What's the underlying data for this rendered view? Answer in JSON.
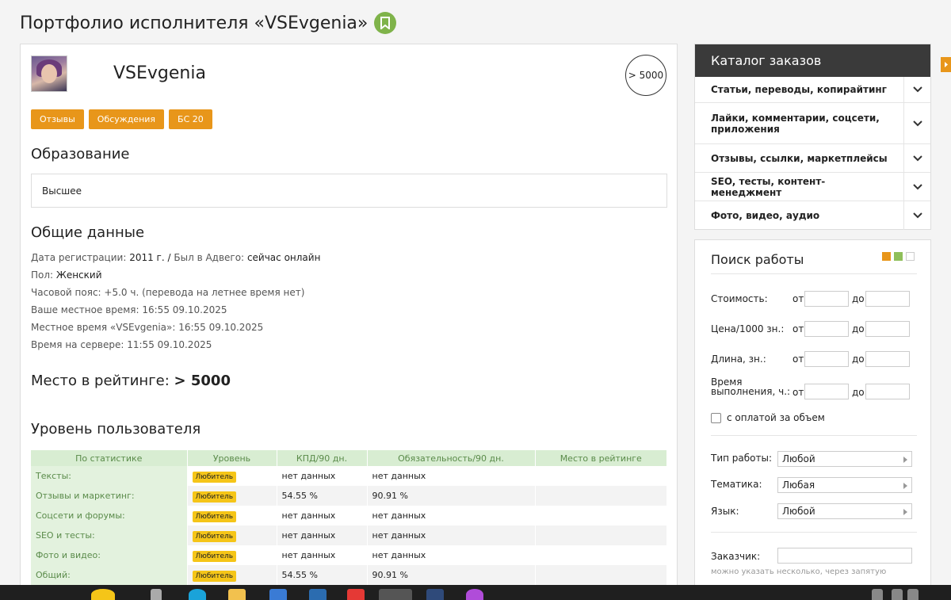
{
  "page": {
    "title": "Портфолио исполнителя «VSEvgenia»"
  },
  "profile": {
    "username": "VSEvgenia",
    "rating_badge": "> 5000"
  },
  "tags": [
    "Отзывы",
    "Обсуждения",
    "БС 20"
  ],
  "education": {
    "heading": "Образование",
    "value": "Высшее"
  },
  "general": {
    "heading": "Общие данные",
    "reg_label": "Дата регистрации:",
    "reg_value": "2011 г.",
    "sep": "/",
    "seen_label": "Был в Адвего:",
    "seen_value": "сейчас онлайн",
    "gender_label": "Пол:",
    "gender_value": "Женский",
    "tz_line": "Часовой пояс: +5.0 ч. (перевода на летнее время нет)",
    "local_time_line": "Ваше местное время: 16:55 09.10.2025",
    "user_time_line": "Местное время «VSEvgenia»: 16:55 09.10.2025",
    "server_time_line": "Время на сервере: 11:55 09.10.2025"
  },
  "rank": {
    "label": "Место в рейтинге:",
    "value": "> 5000"
  },
  "level": {
    "heading": "Уровень пользователя",
    "columns": [
      "По статистике",
      "Уровень",
      "КПД/90 дн.",
      "Обязательность/90 дн.",
      "Место в рейтинге"
    ],
    "rows": [
      {
        "cat": "Тексты:",
        "level": "Любитель",
        "kpd": "нет данных",
        "duty": "нет данных",
        "place": ""
      },
      {
        "cat": "Отзывы и маркетинг:",
        "level": "Любитель",
        "kpd": "54.55 %",
        "duty": "90.91 %",
        "place": ""
      },
      {
        "cat": "Соцсети и форумы:",
        "level": "Любитель",
        "kpd": "нет данных",
        "duty": "нет данных",
        "place": ""
      },
      {
        "cat": "SEO и тесты:",
        "level": "Любитель",
        "kpd": "нет данных",
        "duty": "нет данных",
        "place": ""
      },
      {
        "cat": "Фото и видео:",
        "level": "Любитель",
        "kpd": "нет данных",
        "duty": "нет данных",
        "place": ""
      },
      {
        "cat": "Общий:",
        "level": "Любитель",
        "kpd": "54.55 %",
        "duty": "90.91 %",
        "place": ""
      }
    ]
  },
  "catalog": {
    "heading": "Каталог заказов",
    "items": [
      "Статьи, переводы, копирайтинг",
      "Лайки, комментарии, соцсети, приложения",
      "Отзывы, ссылки, маркетплейсы",
      "SEO, тесты, контент-менеджмент",
      "Фото, видео, аудио"
    ]
  },
  "search": {
    "heading": "Поиск работы",
    "view_colors": [
      "#e8961a",
      "#8fbf5a",
      "#ffffff"
    ],
    "from": "от",
    "to": "до",
    "cost_label": "Стоимость:",
    "price_label": "Цена/1000 зн.:",
    "length_label": "Длина, зн.:",
    "time_label_1": "Время",
    "time_label_2": "выполнения, ч.:",
    "volume_label": "с оплатой за объем",
    "work_type_label": "Тип работы:",
    "work_type_value": "Любой",
    "topic_label": "Тематика:",
    "topic_value": "Любая",
    "lang_label": "Язык:",
    "lang_value": "Любой",
    "customer_label": "Заказчик:",
    "customer_hint": "можно указать несколько, через запятую"
  }
}
